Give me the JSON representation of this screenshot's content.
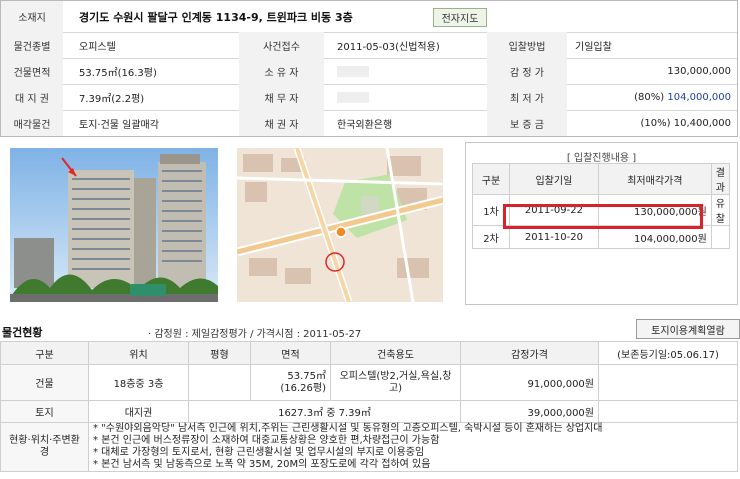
{
  "info": {
    "rows": [
      {
        "cells": [
          {
            "label": "소재지",
            "value": "경기도 수원시 팔달구 인계동 1134-9, 트윈파크 비동 3층"
          }
        ],
        "map_button": "전자지도"
      },
      {
        "cells": [
          {
            "label": "물건종별",
            "value": "오피스텔"
          },
          {
            "label": "사건접수",
            "value": "2011-05-03(신법적용)"
          },
          {
            "label": "입찰방법",
            "value": "기일입찰"
          }
        ]
      },
      {
        "cells": [
          {
            "label": "건물면적",
            "value": "53.75㎡(16.3평)"
          },
          {
            "label": "소 유 자",
            "value": ""
          },
          {
            "label": "감 정 가",
            "value": "130,000,000"
          }
        ]
      },
      {
        "cells": [
          {
            "label": "대 지 권",
            "value": "7.39㎡(2.2평)"
          },
          {
            "label": "채 무 자",
            "value": ""
          },
          {
            "label": "최 저 가",
            "value_prefix": "(80%)",
            "value": "104,000,000"
          }
        ]
      },
      {
        "cells": [
          {
            "label": "매각물건",
            "value": "토지·건물 일괄매각"
          },
          {
            "label": "채 권 자",
            "value": "한국외환은행"
          },
          {
            "label": "보 증 금",
            "value_prefix": "(10%)",
            "value": "10,400,000"
          }
        ]
      }
    ]
  },
  "bidding": {
    "title": "[ 입찰진행내용 ]",
    "headers": [
      "구분",
      "입찰기일",
      "최저매각가격",
      "결과"
    ],
    "rows": [
      [
        "1차",
        "2011-09-22",
        "130,000,000원",
        "유찰"
      ],
      [
        "2차",
        "2011-10-20",
        "104,000,000원",
        ""
      ]
    ]
  },
  "status": {
    "title": "물건현황",
    "info": "· 감정원 : 제일감정평가 / 가격시점 : 2011-05-27",
    "plan_button": "토지이용계획열람",
    "headers": [
      "구분",
      "위치",
      "평형",
      "면적",
      "건축용도",
      "감정가격",
      "(보존등기일:05.06.17)"
    ],
    "building": {
      "label": "건물",
      "location": "18층중 3층",
      "area1": "53.75㎡",
      "area2": "(16.26평)",
      "use": "오피스텔(방2,거실,욕실,창고)",
      "price": "91,000,000원"
    },
    "land": {
      "label": "토지",
      "location": "대지권",
      "area": "1627.3㎡ 중 7.39㎡",
      "price": "39,000,000원"
    },
    "surroundings": {
      "label": "현황·위치·주변환경",
      "notes": [
        "* \"수원야외음악당\" 남서측 인근에 위치,주위는 근린생활시설 및 동유형의 고층오피스텔, 숙박시설 등이 혼재하는 상업지대",
        "* 본건 인근에 버스정류장이 소재하여 대중교통상황은 양호한 편,차량접근이 가능함",
        "* 대체로 가장형의 토지로서, 현황 근린생활시설 및 업무시설의 부지로 이용중임",
        "* 본건 남서측 및 남동측으로 노폭 약 35M, 20M의 포장도로에 각각 접하여 있음"
      ]
    }
  },
  "colors": {
    "accent_red": "#d8232a",
    "value_blue": "#1a3fa8",
    "header_bg": "#f2f2f2"
  }
}
